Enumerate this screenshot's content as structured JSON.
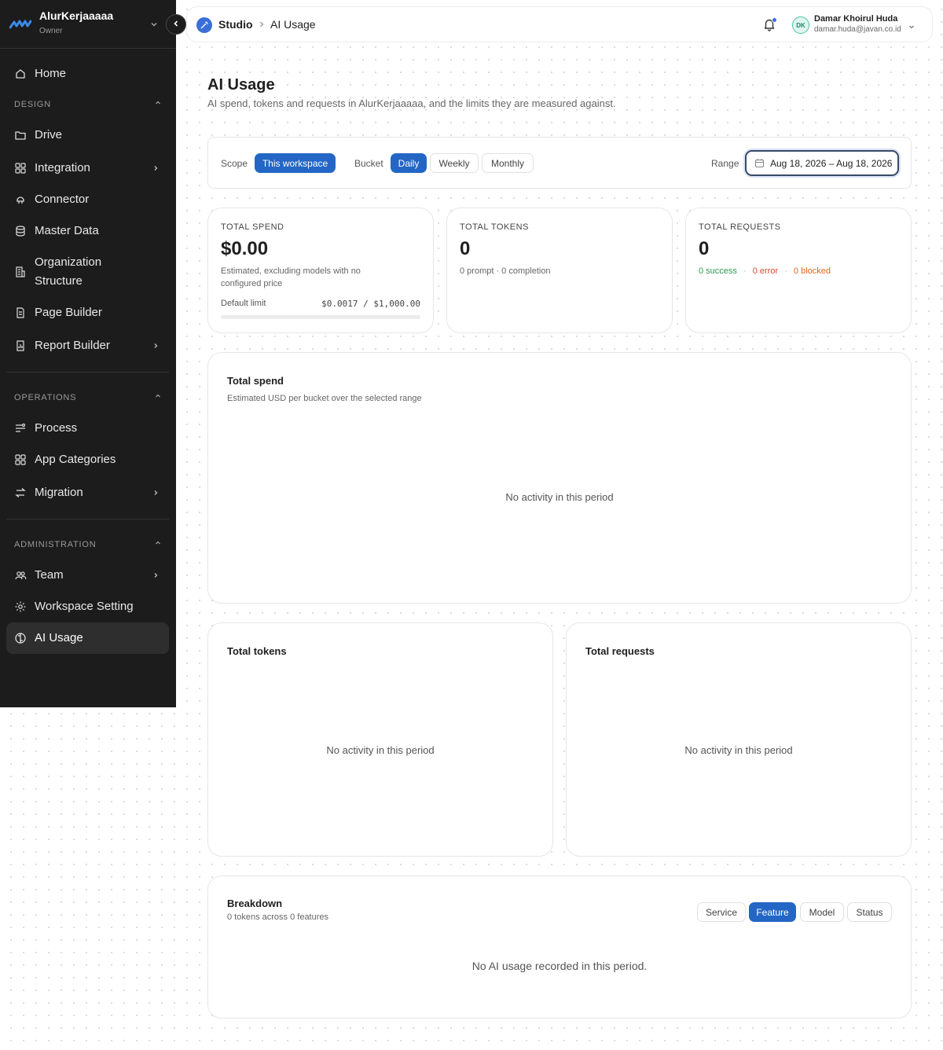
{
  "workspace": {
    "name": "AlurKerjaaaaa",
    "role": "Owner"
  },
  "sidebar": {
    "home": "Home",
    "design_label": "DESIGN",
    "design_items": [
      "Drive",
      "Integration",
      "Connector",
      "Master Data",
      "Organization Structure",
      "Page Builder",
      "Report Builder"
    ],
    "operations_label": "OPERATIONS",
    "operations_items": [
      "Process",
      "App Categories",
      "Migration"
    ],
    "administration_label": "ADMINISTRATION",
    "administration_items": [
      "Team",
      "Workspace Setting",
      "AI Usage"
    ]
  },
  "topbar": {
    "crumb_root": "Studio",
    "crumb_page": "AI Usage",
    "user_initials": "DK",
    "user_name": "Damar Khoirul Huda",
    "user_email": "damar.huda@javan.co.id"
  },
  "page": {
    "title": "AI Usage",
    "subtitle": "AI spend, tokens and requests in AlurKerjaaaaa, and the limits they are measured against."
  },
  "filters": {
    "scope_label": "Scope",
    "scope_value": "This workspace",
    "bucket_label": "Bucket",
    "buckets": [
      "Daily",
      "Weekly",
      "Monthly"
    ],
    "selected_bucket": "Daily",
    "range_label": "Range",
    "range_value": "Aug 18, 2026 – Aug 18, 2026"
  },
  "stats": {
    "spend": {
      "label": "TOTAL SPEND",
      "value": "$0.00",
      "note": "Estimated, excluding models with no configured price",
      "limit_label": "Default limit",
      "limit_value": "$0.0017 / $1,000.00",
      "limit_fraction": 1.7e-06
    },
    "tokens": {
      "label": "TOTAL TOKENS",
      "value": "0",
      "breakdown": "0 prompt · 0 completion"
    },
    "requests": {
      "label": "TOTAL REQUESTS",
      "value": "0",
      "success": "0 success",
      "error": "0 error",
      "blocked": "0 blocked",
      "sep": "·"
    }
  },
  "charts": {
    "spend": {
      "title": "Total spend",
      "subtitle": "Estimated USD per bucket over the selected range",
      "empty": "No activity in this period"
    },
    "tokens": {
      "title": "Total tokens",
      "empty": "No activity in this period"
    },
    "requests": {
      "title": "Total requests",
      "empty": "No activity in this period"
    }
  },
  "breakdown": {
    "title": "Breakdown",
    "subtitle": "0 tokens across 0 features",
    "tabs": [
      "Service",
      "Feature",
      "Model",
      "Status"
    ],
    "selected": "Feature",
    "empty": "No AI usage recorded in this period."
  },
  "colors": {
    "accent": "#2466c5",
    "success": "#2e9a4f",
    "error": "#e0452f",
    "blocked": "#e0661e",
    "sidebar_bg": "#1c1c1c"
  }
}
